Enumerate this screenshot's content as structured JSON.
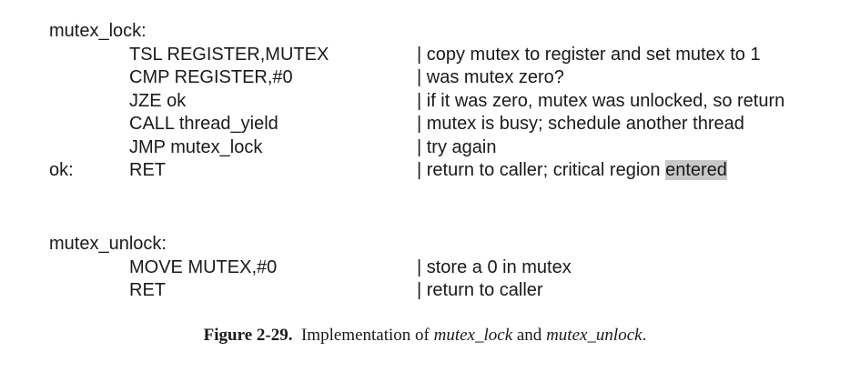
{
  "block1": {
    "header": "mutex_lock:",
    "lines": [
      {
        "label": "",
        "instr": "TSL REGISTER,MUTEX",
        "comment": "| copy mutex to register and set mutex to 1"
      },
      {
        "label": "",
        "instr": "CMP REGISTER,#0",
        "comment": "| was mutex zero?"
      },
      {
        "label": "",
        "instr": "JZE ok",
        "comment": "| if it was zero, mutex was unlocked, so return"
      },
      {
        "label": "",
        "instr": "CALL thread_yield",
        "comment": "| mutex is busy; schedule another thread"
      },
      {
        "label": "",
        "instr": "JMP mutex_lock",
        "comment": "| try again"
      },
      {
        "label": "ok:",
        "instr": "RET",
        "comment_prefix": "| return to caller; critical region ",
        "comment_highlight": "entered"
      }
    ]
  },
  "block2": {
    "header": "mutex_unlock:",
    "lines": [
      {
        "label": "",
        "instr": "MOVE MUTEX,#0",
        "comment": "| store a 0 in mutex"
      },
      {
        "label": "",
        "instr": "RET",
        "comment": "| return to caller"
      }
    ]
  },
  "caption": {
    "number": "Figure 2-29.",
    "text_before": "Implementation of",
    "term1": "mutex_lock",
    "text_mid": "and",
    "term2": "mutex_unlock",
    "text_end": "."
  },
  "colors": {
    "highlight": "#c8c8c8",
    "text": "#1a1a1a"
  }
}
